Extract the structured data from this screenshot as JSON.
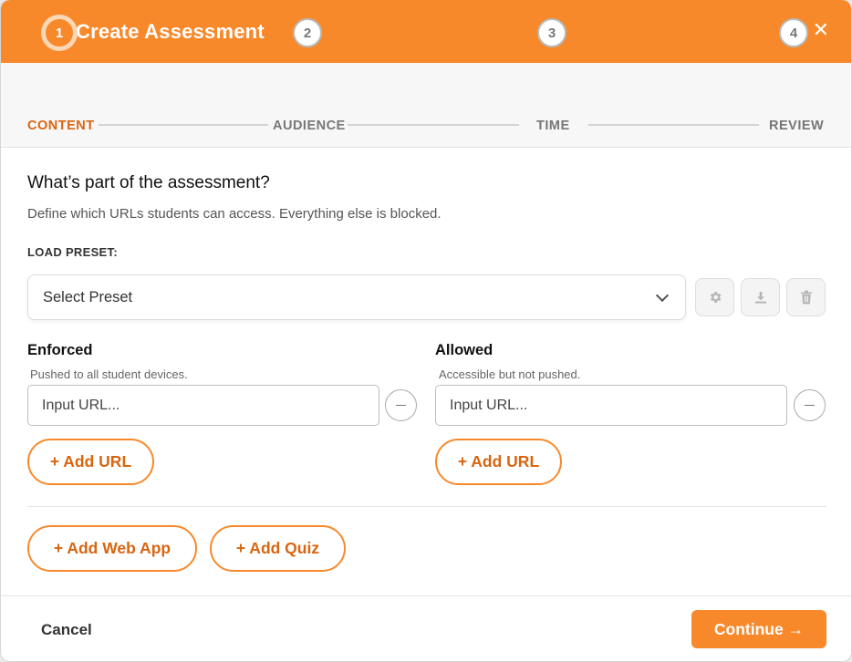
{
  "header": {
    "title": "Create Assessment",
    "menu_icon": "hamburger-menu-icon",
    "close_label": "✕"
  },
  "steps": [
    {
      "number": "1",
      "label": "CONTENT",
      "active": true
    },
    {
      "number": "2",
      "label": "AUDIENCE",
      "active": false
    },
    {
      "number": "3",
      "label": "TIME",
      "active": false
    },
    {
      "number": "4",
      "label": "REVIEW",
      "active": false
    }
  ],
  "main": {
    "question": "What’s part of the assessment?",
    "description": "Define which URLs students can access. Everything else is blocked.",
    "preset_label": "LOAD PRESET:",
    "preset_select": "Select Preset",
    "preset_actions": [
      "gear-icon",
      "download-icon",
      "trash-icon"
    ],
    "enforced": {
      "title": "Enforced",
      "subtitle": "Pushed to all student devices.",
      "input_placeholder": "Input URL...",
      "add_label": "+ Add URL"
    },
    "allowed": {
      "title": "Allowed",
      "subtitle": "Accessible but not pushed.",
      "input_placeholder": "Input URL...",
      "add_label": "+ Add URL"
    },
    "add_web_app": "+ Add Web App",
    "add_quiz": "+ Add Quiz"
  },
  "footer": {
    "cancel": "Cancel",
    "continue": "Continue →"
  },
  "colors": {
    "accent": "#f7892b",
    "accent_text": "#d9650f"
  }
}
